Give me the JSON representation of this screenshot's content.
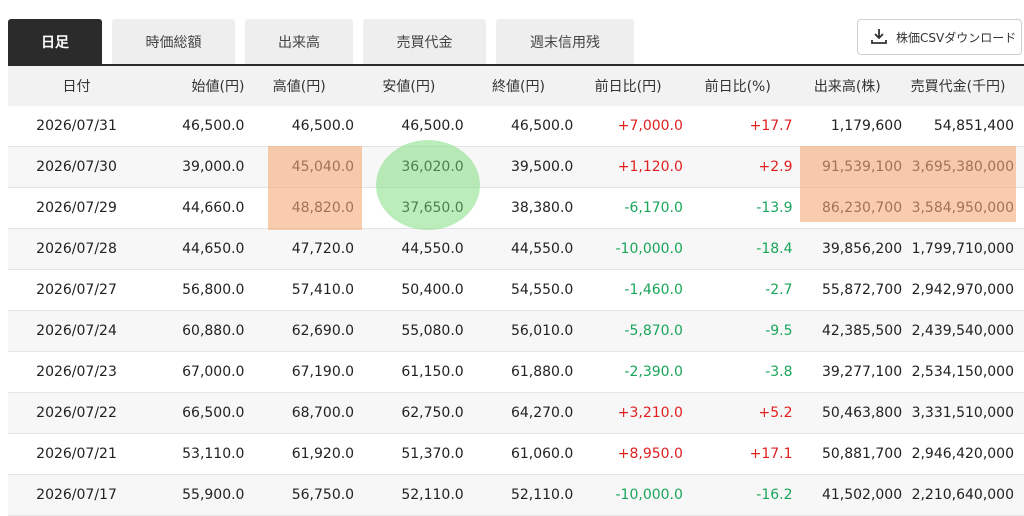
{
  "tabs": [
    {
      "label": "日足",
      "active": true
    },
    {
      "label": "時価総額",
      "active": false
    },
    {
      "label": "出来高",
      "active": false
    },
    {
      "label": "売買代金",
      "active": false
    },
    {
      "label": "週末信用残",
      "active": false
    }
  ],
  "download_label": "株価CSVダウンロード",
  "columns": [
    "日付",
    "始値(円)",
    "高値(円)",
    "安値(円)",
    "終値(円)",
    "前日比(円)",
    "前日比(%)",
    "出来高(株)",
    "売買代金(千円)"
  ],
  "rows": [
    {
      "date": "2026/07/31",
      "open": "46,500.0",
      "high": "46,500.0",
      "low": "46,500.0",
      "close": "46,500.0",
      "chg": "+7,000.0",
      "pct": "+17.7",
      "vol": "1,179,600",
      "value": "54,851,400",
      "dir": "pos"
    },
    {
      "date": "2026/07/30",
      "open": "39,000.0",
      "high": "45,040.0",
      "low": "36,020.0",
      "close": "39,500.0",
      "chg": "+1,120.0",
      "pct": "+2.9",
      "vol": "91,539,100",
      "value": "3,695,380,000",
      "dir": "pos"
    },
    {
      "date": "2026/07/29",
      "open": "44,660.0",
      "high": "48,820.0",
      "low": "37,650.0",
      "close": "38,380.0",
      "chg": "-6,170.0",
      "pct": "-13.9",
      "vol": "86,230,700",
      "value": "3,584,950,000",
      "dir": "neg"
    },
    {
      "date": "2026/07/28",
      "open": "44,650.0",
      "high": "47,720.0",
      "low": "44,550.0",
      "close": "44,550.0",
      "chg": "-10,000.0",
      "pct": "-18.4",
      "vol": "39,856,200",
      "value": "1,799,710,000",
      "dir": "neg"
    },
    {
      "date": "2026/07/27",
      "open": "56,800.0",
      "high": "57,410.0",
      "low": "50,400.0",
      "close": "54,550.0",
      "chg": "-1,460.0",
      "pct": "-2.7",
      "vol": "55,872,700",
      "value": "2,942,970,000",
      "dir": "neg"
    },
    {
      "date": "2026/07/24",
      "open": "60,880.0",
      "high": "62,690.0",
      "low": "55,080.0",
      "close": "56,010.0",
      "chg": "-5,870.0",
      "pct": "-9.5",
      "vol": "42,385,500",
      "value": "2,439,540,000",
      "dir": "neg"
    },
    {
      "date": "2026/07/23",
      "open": "67,000.0",
      "high": "67,190.0",
      "low": "61,150.0",
      "close": "61,880.0",
      "chg": "-2,390.0",
      "pct": "-3.8",
      "vol": "39,277,100",
      "value": "2,534,150,000",
      "dir": "neg"
    },
    {
      "date": "2026/07/22",
      "open": "66,500.0",
      "high": "68,700.0",
      "low": "62,750.0",
      "close": "64,270.0",
      "chg": "+3,210.0",
      "pct": "+5.2",
      "vol": "50,463,800",
      "value": "3,331,510,000",
      "dir": "pos"
    },
    {
      "date": "2026/07/21",
      "open": "53,110.0",
      "high": "61,920.0",
      "low": "51,370.0",
      "close": "61,060.0",
      "chg": "+8,950.0",
      "pct": "+17.1",
      "vol": "50,881,700",
      "value": "2,946,420,000",
      "dir": "pos"
    },
    {
      "date": "2026/07/17",
      "open": "55,900.0",
      "high": "56,750.0",
      "low": "52,110.0",
      "close": "52,110.0",
      "chg": "-10,000.0",
      "pct": "-16.2",
      "vol": "41,502,000",
      "value": "2,210,640,000",
      "dir": "neg"
    }
  ],
  "colors": {
    "positive": "#e02020",
    "negative": "#1aa55a",
    "highlight_orange": "#f5aa78",
    "highlight_green": "#78dc78"
  }
}
